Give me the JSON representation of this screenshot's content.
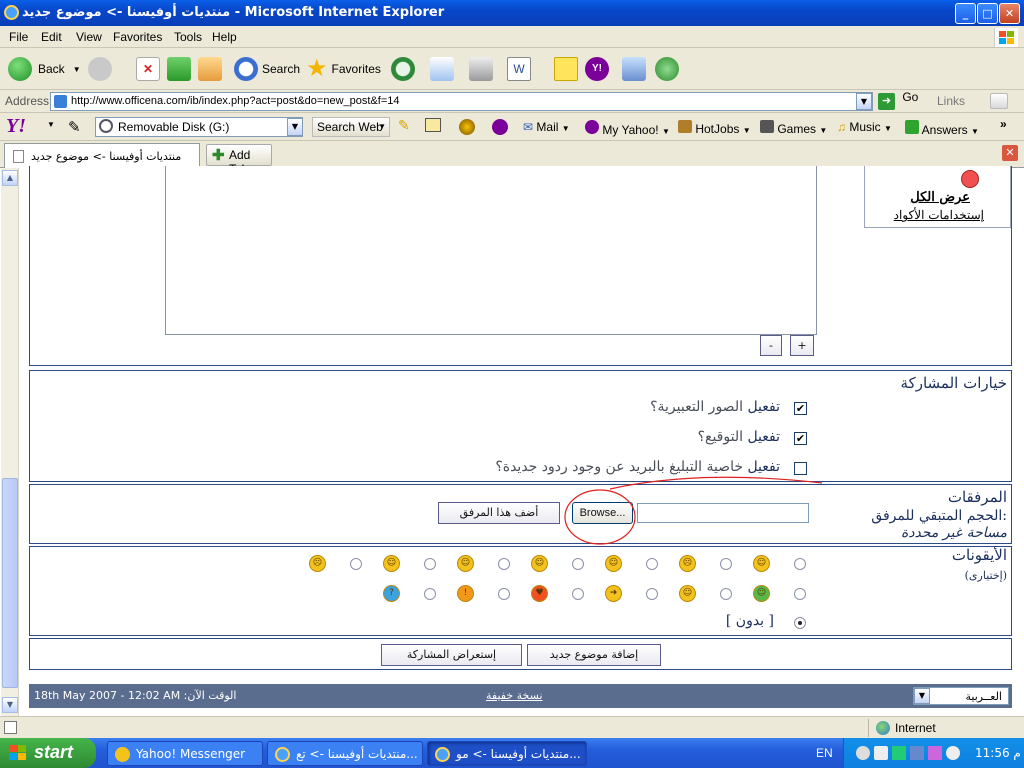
{
  "window": {
    "title": "منتديات أوفيسنا -> موضوع جديد - Microsoft Internet Explorer",
    "min": "_",
    "max": "□",
    "close": "✕"
  },
  "menu": [
    "File",
    "Edit",
    "View",
    "Favorites",
    "Tools",
    "Help"
  ],
  "toolbar": {
    "back": "Back",
    "search": "Search",
    "favorites": "Favorites"
  },
  "address": {
    "label": "Address",
    "url": "http://www.officena.com/ib/index.php?act=post&do=new_post&f=14",
    "go": "Go",
    "links": "Links"
  },
  "yahoo": {
    "logo": "Y!",
    "search_field": "Removable Disk (G:)",
    "search_web": "Search Web",
    "mail": "Mail",
    "my_yahoo": "My Yahoo!",
    "hotjobs": "HotJobs",
    "games": "Games",
    "music": "Music",
    "answers": "Answers",
    "more": "»"
  },
  "tabs": {
    "active": "منتديات أوفيسنا -> موضوع جديد",
    "add": "Add Tab"
  },
  "sidebar_links": {
    "show_all": "عرض الكل",
    "code_usage": "إستخدامات الأكواد"
  },
  "editor": {
    "minus": "-",
    "plus": "+"
  },
  "options": {
    "title": "خيارات المشاركة",
    "items": [
      {
        "strong": "تفعيل",
        "rest": " الصور التعبيرية؟",
        "checked": true
      },
      {
        "strong": "تفعيل",
        "rest": " التوقيع؟",
        "checked": true
      },
      {
        "strong": "تفعيل",
        "rest": " خاصية التبليغ بالبريد عن وجود ردود جديدة؟",
        "checked": false
      }
    ]
  },
  "attachments": {
    "title": "المرفقات",
    "space_label": "الحجم المتبقي للمرفق:",
    "space_value": "مساحة غير محددة",
    "browse": "Browse...",
    "add_button": "أضف هذا المرفق"
  },
  "icons_section": {
    "title": "الأيقونات",
    "optional": "(إختيارى)",
    "none_label": "[  بدون  ]"
  },
  "actions": {
    "submit": "إضافة موضوع جديد",
    "preview": "إستعراض المشاركة"
  },
  "footer": {
    "lang": "العــربية",
    "lite": "نسخة خفيفة",
    "time": "الوقت الآن: 18th May 2007 - 12:02 AM"
  },
  "status": {
    "zone": "Internet"
  },
  "taskbar": {
    "start": "start",
    "tasks": [
      "Yahoo! Messenger",
      "منتديات أوفيسنا -> تع...",
      "منتديات أوفيسنا -> مو..."
    ],
    "lang": "EN",
    "clock": "11:56 م"
  },
  "colors": {
    "accent": "#2d4b87",
    "title_text": "#1b2f5c",
    "highlight_circle": "#e0201c"
  }
}
